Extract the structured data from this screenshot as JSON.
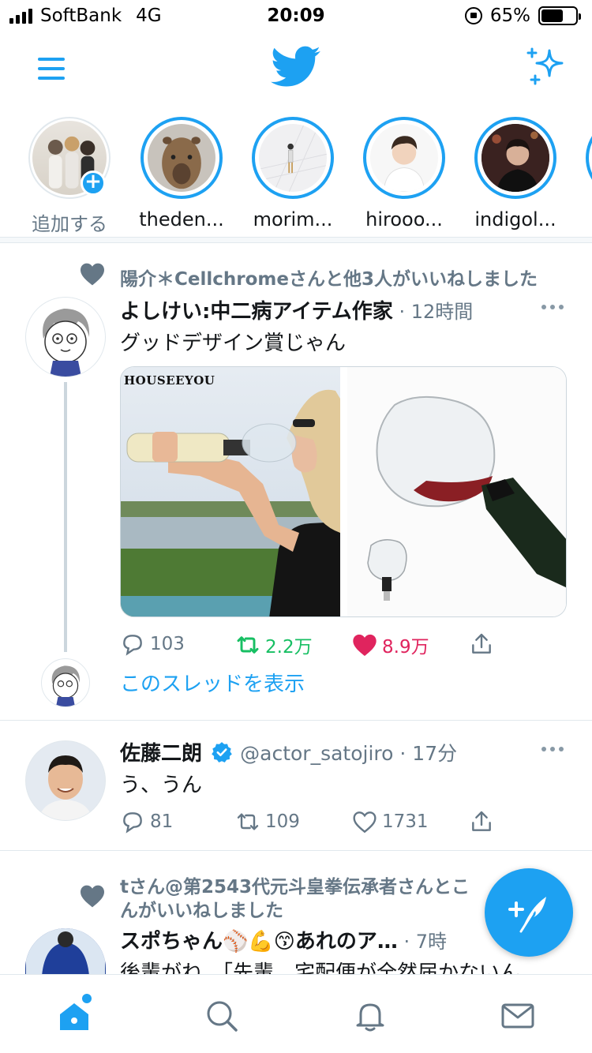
{
  "status_bar": {
    "carrier": "SoftBank",
    "network": "4G",
    "time": "20:09",
    "battery": "65%",
    "battery_level": 0.65
  },
  "nav": {
    "menu_icon": "hamburger-menu-icon",
    "logo_icon": "twitter-bird-icon",
    "sparkle_icon": "sparkle-icon"
  },
  "fleets": [
    {
      "name": "追加する",
      "self": true
    },
    {
      "name": "theden..."
    },
    {
      "name": "morim..."
    },
    {
      "name": "hirooo..."
    },
    {
      "name": "indigol..."
    }
  ],
  "tweets": [
    {
      "social_context": "陽介＊Cellchromeさんと他3人がいいねしました",
      "author": "よしけい:中二病アイテム作家",
      "time": "12時間",
      "text": "グッドデザイン賞じゃん",
      "media_brand": "HOUSEEYOU",
      "replies": "103",
      "retweets": "2.2万",
      "likes": "8.9万",
      "retweeted": true,
      "liked": true,
      "show_thread": "このスレッドを表示"
    },
    {
      "author": "佐藤二朗",
      "verified": true,
      "handle": "@actor_satojiro",
      "time": "17分",
      "text": "う、うん",
      "replies": "81",
      "retweets": "109",
      "likes": "1731"
    },
    {
      "social_context_line1": "tさん@第2543代元斗皇拳伝承者さんとこ",
      "social_context_line2": "んがいいねしました",
      "author": "スポちゃん⚾💪😙あれのア…",
      "time": "7時",
      "text": "後輩がね、「先輩、宅配便が全然届かないん"
    }
  ],
  "tabbar": {
    "home_icon": "home-icon",
    "search_icon": "search-icon",
    "notifications_icon": "bell-icon",
    "messages_icon": "envelope-icon"
  },
  "colors": {
    "accent": "#1da1f2",
    "retweet": "#17bf63",
    "like": "#e0245e",
    "secondary_text": "#657786"
  }
}
